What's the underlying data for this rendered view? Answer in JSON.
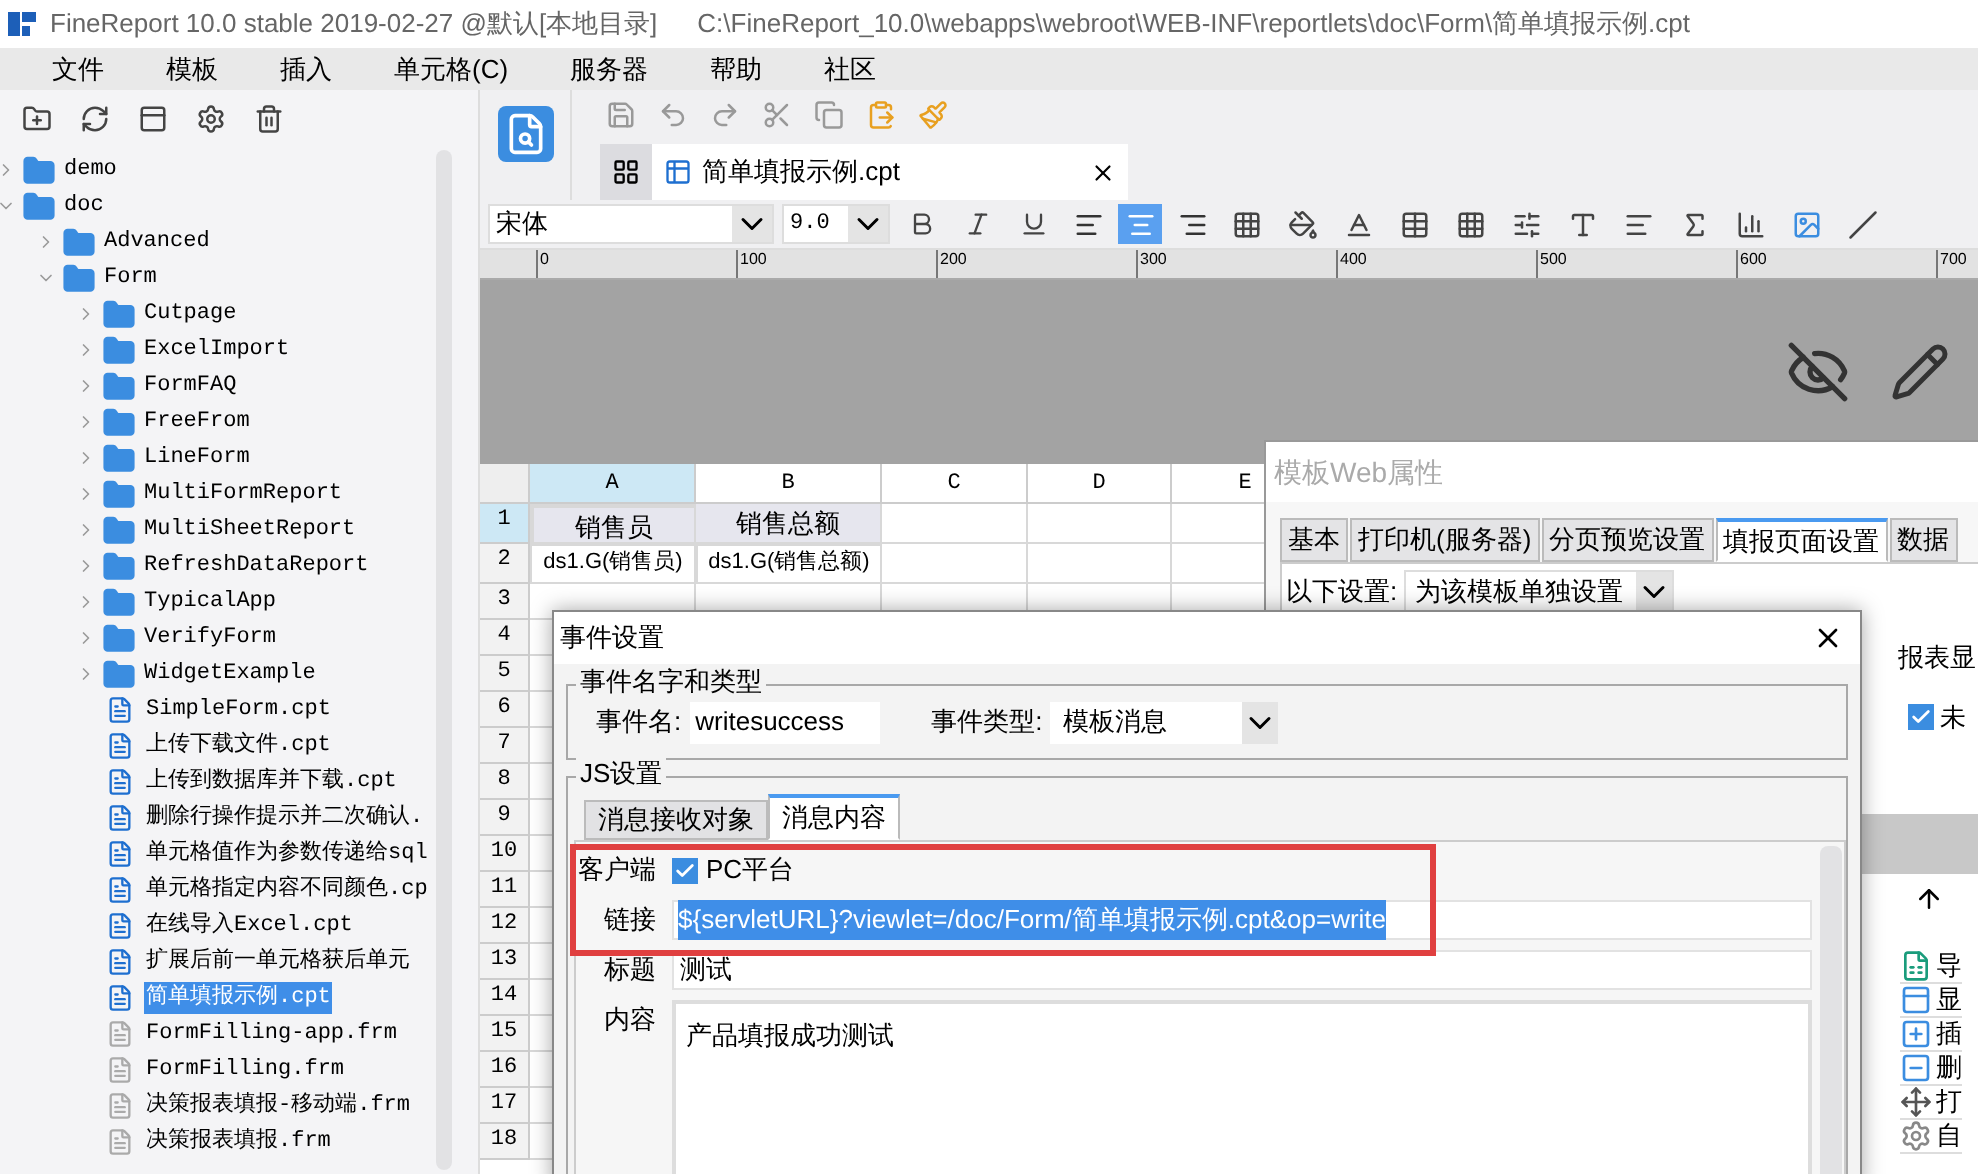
{
  "window": {
    "title": "FineReport 10.0 stable 2019-02-27 @默认[本地目录]",
    "path": "C:\\FineReport_10.0\\webapps\\webroot\\WEB-INF\\reportlets\\doc\\Form\\简单填报示例.cpt"
  },
  "menu": [
    "文件",
    "模板",
    "插入",
    "单元格(C)",
    "服务器",
    "帮助",
    "社区"
  ],
  "tree": [
    {
      "label": "demo",
      "kind": "folder",
      "expanded": false,
      "selected": false
    },
    {
      "label": "doc",
      "kind": "folder",
      "expanded": true,
      "selected": false,
      "children": [
        {
          "label": "Advanced",
          "kind": "folder",
          "expanded": false,
          "selected": false
        },
        {
          "label": "Form",
          "kind": "folder",
          "expanded": true,
          "selected": false,
          "children": [
            {
              "label": "Cutpage",
              "kind": "folder",
              "expanded": false,
              "selected": false
            },
            {
              "label": "ExcelImport",
              "kind": "folder",
              "expanded": false,
              "selected": false
            },
            {
              "label": "FormFAQ",
              "kind": "folder",
              "expanded": false,
              "selected": false
            },
            {
              "label": "FreeFrom",
              "kind": "folder",
              "expanded": false,
              "selected": false
            },
            {
              "label": "LineForm",
              "kind": "folder",
              "expanded": false,
              "selected": false
            },
            {
              "label": "MultiFormReport",
              "kind": "folder",
              "expanded": false,
              "selected": false
            },
            {
              "label": "MultiSheetReport",
              "kind": "folder",
              "expanded": false,
              "selected": false
            },
            {
              "label": "RefreshDataReport",
              "kind": "folder",
              "expanded": false,
              "selected": false
            },
            {
              "label": "TypicalApp",
              "kind": "folder",
              "expanded": false,
              "selected": false
            },
            {
              "label": "VerifyForm",
              "kind": "folder",
              "expanded": false,
              "selected": false
            },
            {
              "label": "WidgetExample",
              "kind": "folder",
              "expanded": false,
              "selected": false
            },
            {
              "label": "SimpleForm.cpt",
              "kind": "report",
              "selected": false
            },
            {
              "label": "上传下载文件.cpt",
              "kind": "report",
              "selected": false
            },
            {
              "label": "上传到数据库并下载.cpt",
              "kind": "report",
              "selected": false
            },
            {
              "label": "删除行操作提示并二次确认.",
              "kind": "report",
              "selected": false
            },
            {
              "label": "单元格值作为参数传递给sql",
              "kind": "report",
              "selected": false
            },
            {
              "label": "单元格指定内容不同颜色.cp",
              "kind": "report",
              "selected": false
            },
            {
              "label": "在线导入Excel.cpt",
              "kind": "report",
              "selected": false
            },
            {
              "label": "扩展后前一单元格获后单元",
              "kind": "report",
              "selected": false
            },
            {
              "label": "简单填报示例.cpt",
              "kind": "report",
              "selected": true
            },
            {
              "label": "FormFilling-app.frm",
              "kind": "form",
              "selected": false
            },
            {
              "label": "FormFilling.frm",
              "kind": "form",
              "selected": false
            },
            {
              "label": "决策报表填报-移动端.frm",
              "kind": "form",
              "selected": false
            },
            {
              "label": "决策报表填报.frm",
              "kind": "form",
              "selected": false
            }
          ]
        }
      ]
    }
  ],
  "editor_tab": {
    "label": "简单填报示例.cpt"
  },
  "format_toolbar": {
    "font": "宋体",
    "size": "9.0",
    "alignments": [
      {
        "kind": "left",
        "selected": false
      },
      {
        "kind": "center",
        "selected": true
      },
      {
        "kind": "right",
        "selected": false
      }
    ]
  },
  "ruler": [
    "0",
    "100",
    "200",
    "300",
    "400",
    "500",
    "600",
    "700"
  ],
  "sheet": {
    "columns": [
      {
        "label": "A",
        "selected": true
      },
      {
        "label": "B",
        "selected": false
      },
      {
        "label": "C",
        "selected": false
      },
      {
        "label": "D",
        "selected": false
      },
      {
        "label": "E",
        "selected": false
      }
    ],
    "rows": [
      {
        "label": "1",
        "selected": true,
        "cells": [
          "销售员",
          "销售总额"
        ]
      },
      {
        "label": "2",
        "selected": false,
        "cells": [
          "ds1.G(销售员)",
          "ds1.G(销售总额)"
        ]
      },
      {
        "label": "3",
        "selected": false
      },
      {
        "label": "4",
        "selected": false
      },
      {
        "label": "5",
        "selected": false
      },
      {
        "label": "6",
        "selected": false
      },
      {
        "label": "7",
        "selected": false
      },
      {
        "label": "8",
        "selected": false
      },
      {
        "label": "9",
        "selected": false
      },
      {
        "label": "10",
        "selected": false
      },
      {
        "label": "11",
        "selected": false
      },
      {
        "label": "12",
        "selected": false
      },
      {
        "label": "13",
        "selected": false
      },
      {
        "label": "14",
        "selected": false
      },
      {
        "label": "15",
        "selected": false
      },
      {
        "label": "16",
        "selected": false
      },
      {
        "label": "17",
        "selected": false
      },
      {
        "label": "18",
        "selected": false
      }
    ]
  },
  "web_dialog": {
    "title": "模板Web属性",
    "tabs": [
      {
        "label": "基本",
        "selected": false
      },
      {
        "label": "打印机(服务器)",
        "selected": false
      },
      {
        "label": "分页预览设置",
        "selected": false
      },
      {
        "label": "填报页面设置",
        "selected": true
      },
      {
        "label": "数据",
        "selected": false
      }
    ],
    "setting_label": "以下设置:",
    "setting_value": "为该模板单独设置",
    "side_label": "报表显",
    "checkbox": {
      "label": "未",
      "checked": true
    },
    "list_items": [
      {
        "label": "导",
        "kind": "excel"
      },
      {
        "label": "显",
        "kind": "window"
      },
      {
        "label": "插",
        "kind": "insert"
      },
      {
        "label": "删",
        "kind": "delete"
      },
      {
        "label": "打",
        "kind": "move"
      },
      {
        "label": "自",
        "kind": "gear"
      }
    ]
  },
  "event_dialog": {
    "title": "事件设置",
    "name_group": "事件名字和类型",
    "name_label": "事件名:",
    "name_value": "writesuccess",
    "type_label": "事件类型:",
    "type_value": "模板消息",
    "js_group": "JS设置",
    "tabs": [
      {
        "label": "消息接收对象",
        "selected": false
      },
      {
        "label": "消息内容",
        "selected": true
      }
    ],
    "client_label": "客户端",
    "platform": {
      "label": "PC平台",
      "checked": true
    },
    "link_label": "链接",
    "link_value": "${servletURL}?viewlet=/doc/Form/简单填报示例.cpt&op=write",
    "title_label": "标题",
    "title_value": "测试",
    "content_label": "内容",
    "content_value": "产品填报成功测试"
  }
}
